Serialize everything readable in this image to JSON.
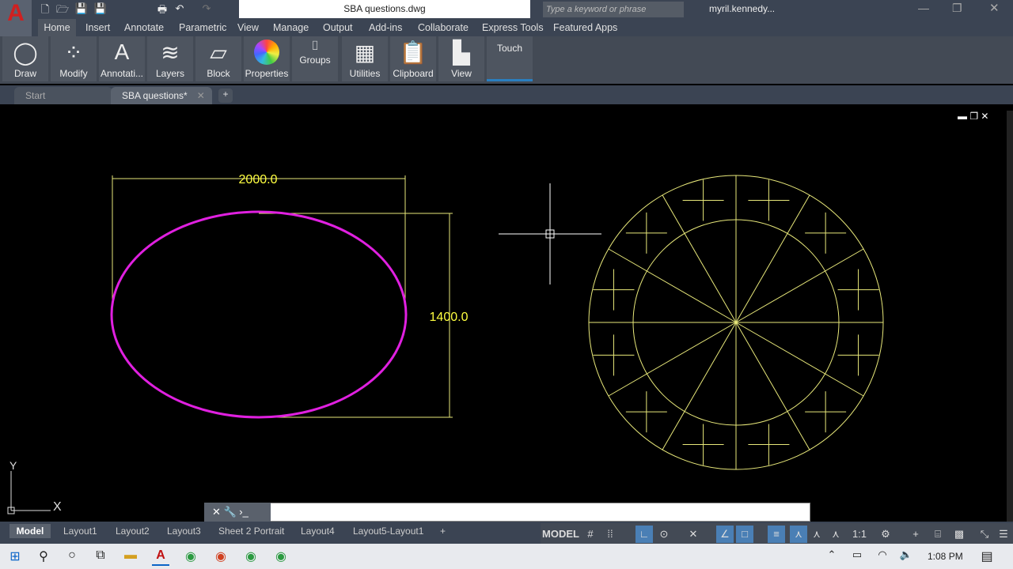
{
  "title": "SBA questions.dwg",
  "search_placeholder": "Type a keyword or phrase",
  "user": "myril.kennedy...",
  "ribbon_tabs": [
    "Home",
    "Insert",
    "Annotate",
    "Parametric",
    "View",
    "Manage",
    "Output",
    "Add-ins",
    "Collaborate",
    "Express Tools",
    "Featured Apps"
  ],
  "panels": [
    "Draw",
    "Modify",
    "Annotati...",
    "Layers",
    "Block",
    "Properties",
    "Groups",
    "Utilities",
    "Clipboard",
    "View",
    "Touch"
  ],
  "file_tabs": [
    "Start",
    "SBA questions*"
  ],
  "drawing": {
    "dim_width": "2000.0",
    "dim_height": "1400.0",
    "ellipse_color": "#e020e0",
    "line_color": "#e8e87a",
    "axis_x": "X",
    "axis_y": "Y"
  },
  "layout_tabs": [
    "Model",
    "Layout1",
    "Layout2",
    "Layout3",
    "Sheet 2 Portrait",
    "Layout4",
    "Layout5-Layout1"
  ],
  "status": {
    "model": "MODEL",
    "scale": "1:1"
  },
  "clock": "1:08 PM"
}
